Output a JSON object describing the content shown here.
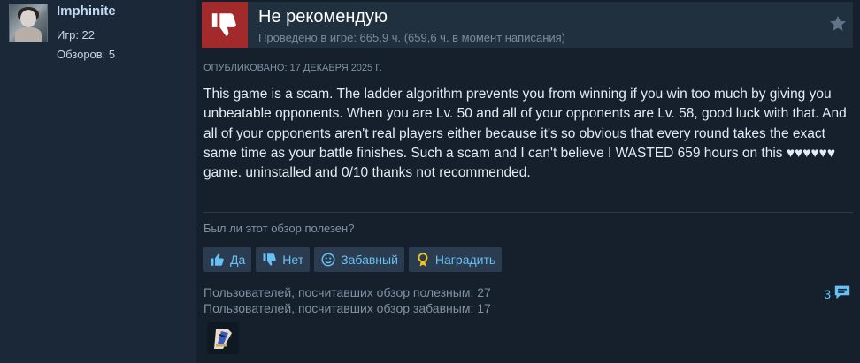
{
  "author": {
    "name": "Imphinite",
    "games_label": "Игр: 22",
    "reviews_label": "Обзоров: 5"
  },
  "review": {
    "verdict": "Не рекомендую",
    "hours": "Проведено в игре: 665,9 ч. (659,6 ч. в момент написания)",
    "posted": "Опубликовано: 17 декабря 2025 г.",
    "text": "This game is a scam. The ladder algorithm prevents you from winning if you win too much by giving you unbeatable opponents. When you are Lv. 50 and all of your opponents are Lv. 58, good luck with that. And all of your opponents aren't real players either because it's so obvious that every round takes the exact same time as your battle finishes. Such a scam and I can't believe I WASTED 659 hours on this ♥♥♥♥♥♥ game. uninstalled and 0/10 thanks not recommended."
  },
  "helpful": {
    "question": "Был ли этот обзор полезен?",
    "yes": "Да",
    "no": "Нет",
    "funny": "Забавный",
    "award": "Наградить"
  },
  "stats": {
    "helpful_count": "Пользователей, посчитавших обзор полезным: 27",
    "funny_count": "Пользователей, посчитавших обзор забавным: 17",
    "comments": "3"
  },
  "colors": {
    "background": "#1b2838",
    "review_panel": "#16202d",
    "thumb_down": "#a32a2a",
    "link": "#67c1f5",
    "button_bg": "#2b3c50"
  },
  "icons": [
    "thumbs-down-icon",
    "star-icon",
    "thumbs-up-icon",
    "smiley-icon",
    "award-ribbon-icon",
    "comment-bubble-icon",
    "award-badge-icon"
  ]
}
